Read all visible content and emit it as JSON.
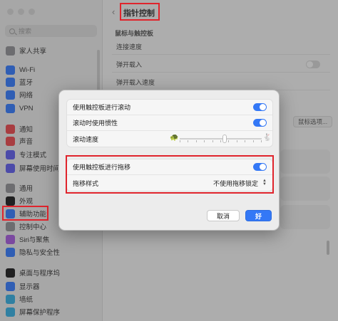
{
  "window": {
    "page_title": "指针控制",
    "section_label": "鼠标与触控板",
    "rows": [
      "连接速度",
      "弹开载入",
      "弹开载入速度"
    ],
    "mouse_options_button": "鼠标选项..."
  },
  "sidebar": {
    "search_placeholder": "搜索",
    "items": [
      {
        "label": "家人共享",
        "color": "#8e8e93"
      },
      {
        "label": "Wi-Fi",
        "color": "#3478f6"
      },
      {
        "label": "蓝牙",
        "color": "#3478f6"
      },
      {
        "label": "网络",
        "color": "#3478f6"
      },
      {
        "label": "VPN",
        "color": "#3478f6"
      },
      {
        "label": "通知",
        "color": "#e5484d"
      },
      {
        "label": "声音",
        "color": "#e5484d"
      },
      {
        "label": "专注模式",
        "color": "#5e5ce6"
      },
      {
        "label": "屏幕使用时间",
        "color": "#5e5ce6"
      },
      {
        "label": "通用",
        "color": "#8e8e93"
      },
      {
        "label": "外观",
        "color": "#1c1c1e"
      },
      {
        "label": "辅助功能",
        "color": "#3478f6"
      },
      {
        "label": "控制中心",
        "color": "#8e8e93"
      },
      {
        "label": "Siri与聚焦",
        "color": "#a259d9"
      },
      {
        "label": "隐私与安全性",
        "color": "#3478f6"
      },
      {
        "label": "桌面与程序坞",
        "color": "#1c1c1e"
      },
      {
        "label": "显示器",
        "color": "#3478f6"
      },
      {
        "label": "墙纸",
        "color": "#34aadc"
      },
      {
        "label": "屏幕保护程序",
        "color": "#34aadc"
      }
    ]
  },
  "dialog": {
    "group1": {
      "scroll_label": "使用触控板进行滚动",
      "inertia_label": "滚动时使用惯性",
      "speed_label": "滚动速度",
      "speed_value": 0.55
    },
    "group2": {
      "drag_label": "使用触控板进行拖移",
      "drag_style_label": "拖移样式",
      "drag_style_value": "不使用拖移锁定"
    },
    "cancel_label": "取消",
    "ok_label": "好"
  },
  "colors": {
    "accent": "#3478f6",
    "highlight": "#e0242c"
  }
}
